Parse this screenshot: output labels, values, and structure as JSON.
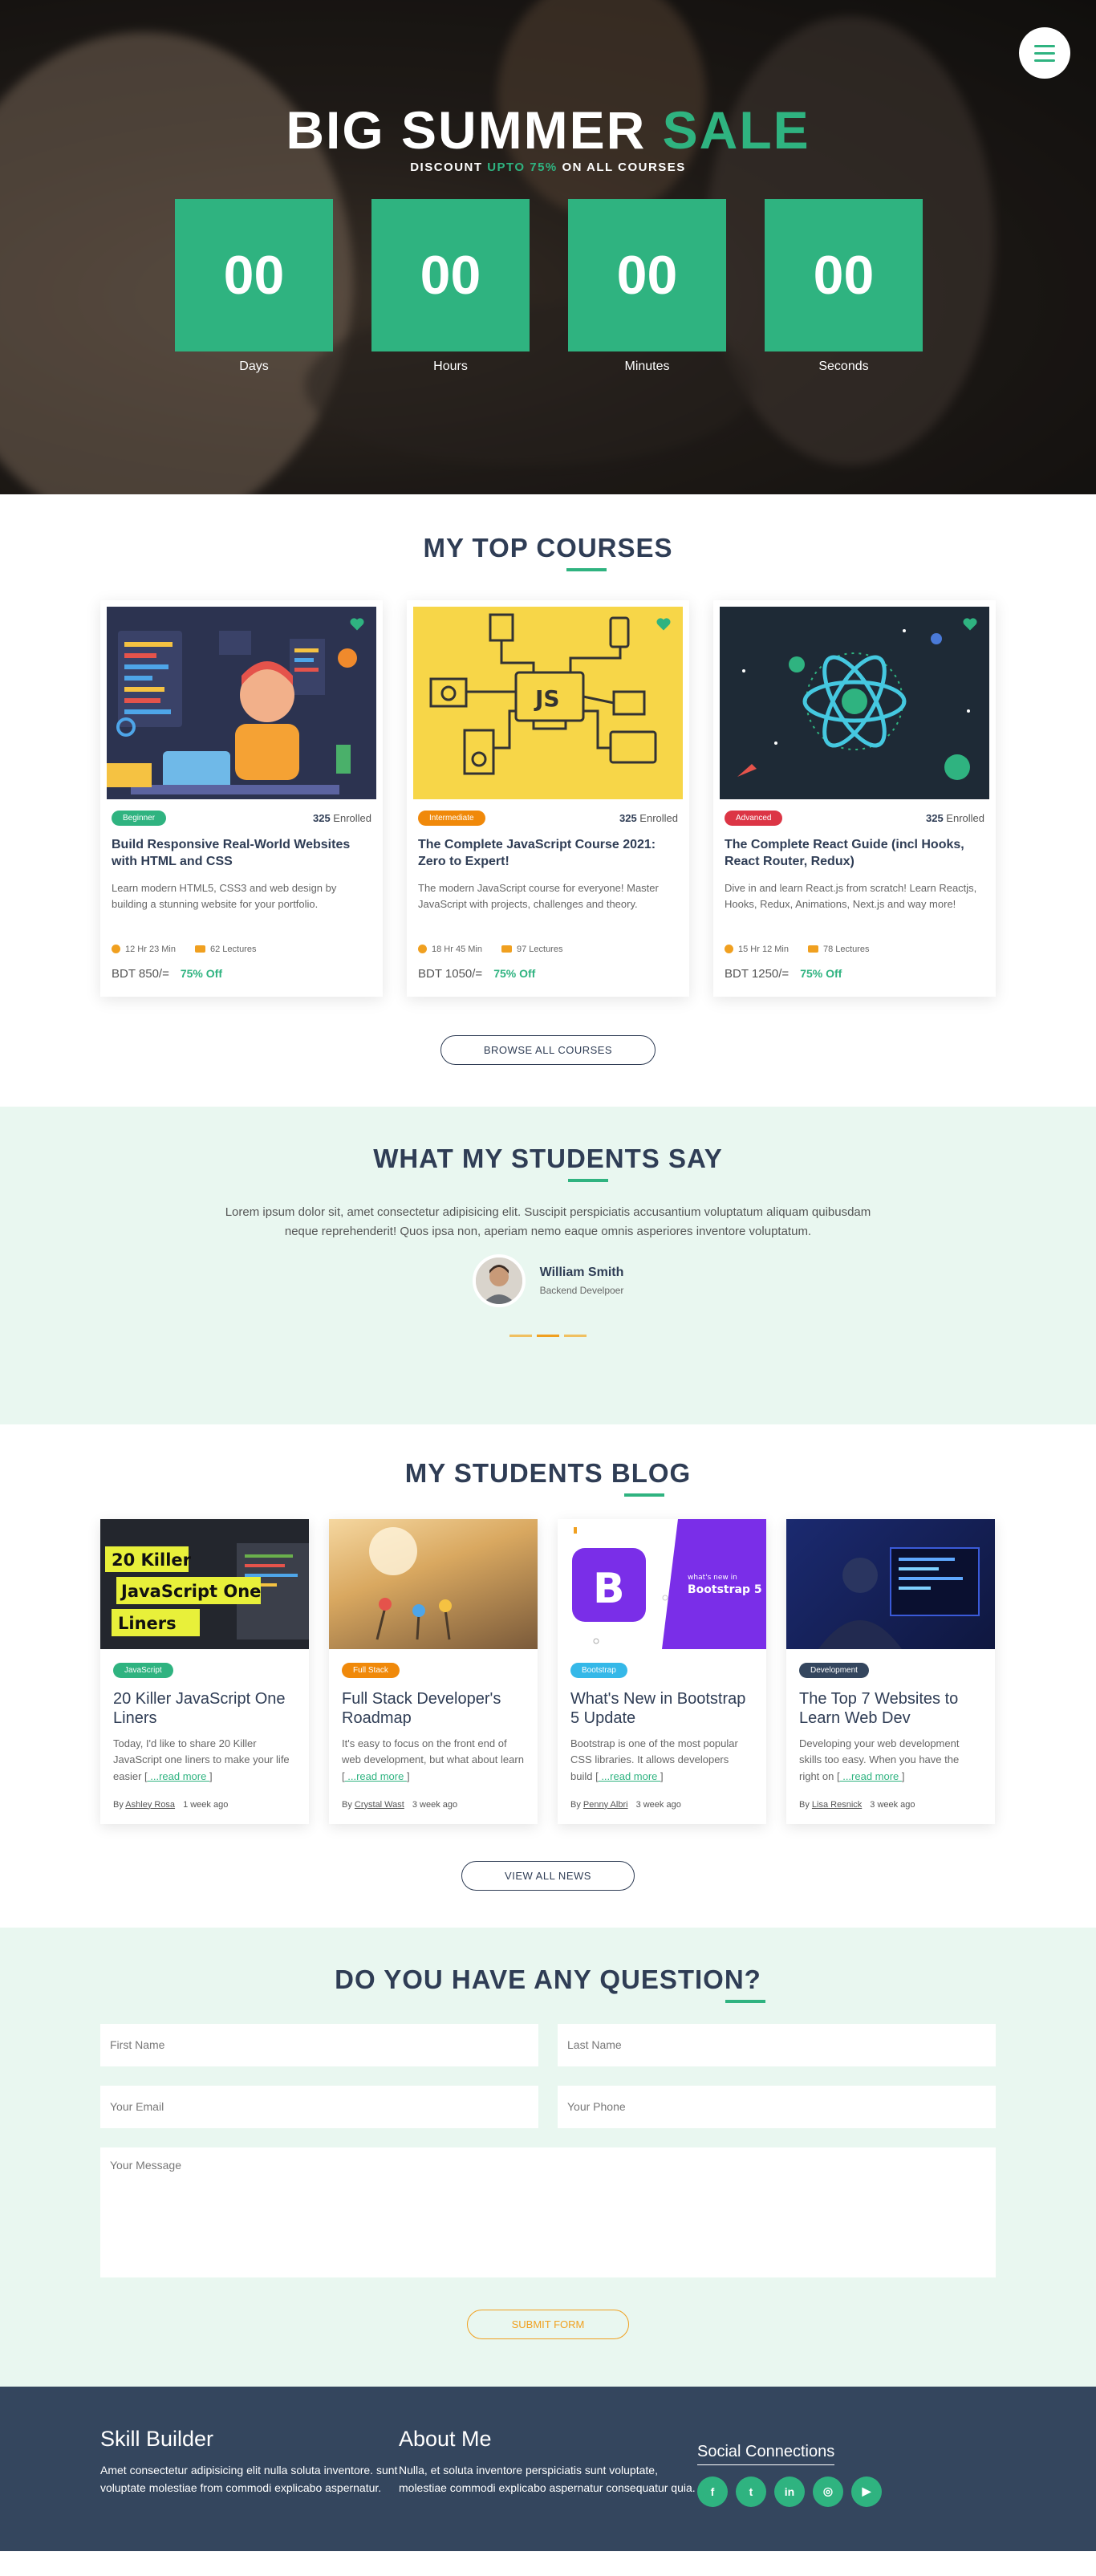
{
  "hero": {
    "title_main": "BIG SUMMER ",
    "title_accent": "SALE",
    "sub_before": "DISCOUNT ",
    "sub_accent": "UPTO 75%",
    "sub_after": " ON ALL COURSES",
    "countdown": [
      {
        "value": "00",
        "label": "Days"
      },
      {
        "value": "00",
        "label": "Hours"
      },
      {
        "value": "00",
        "label": "Minutes"
      },
      {
        "value": "00",
        "label": "Seconds"
      }
    ]
  },
  "courses": {
    "title": "MY TOP COURSES",
    "items": [
      {
        "level": "Beginner",
        "level_color": "#2fb380",
        "enrolled_count": "325",
        "enrolled_label": " Enrolled",
        "title": "Build Responsive Real-World Websites with HTML and CSS",
        "desc": "Learn modern HTML5, CSS3 and web design by building a stunning website for your portfolio.",
        "duration": "12 Hr 23 Min",
        "lectures": "62 Lectures",
        "price": "BDT 850/=",
        "off": "75% Off"
      },
      {
        "level": "Intermediate",
        "level_color": "#f0890a",
        "enrolled_count": "325",
        "enrolled_label": " Enrolled",
        "title": "The Complete JavaScript Course 2021: Zero to Expert!",
        "desc": "The modern JavaScript course for everyone! Master JavaScript with projects, challenges and theory.",
        "duration": "18 Hr 45 Min",
        "lectures": "97 Lectures",
        "price": "BDT 1050/=",
        "off": "75% Off"
      },
      {
        "level": "Advanced",
        "level_color": "#dc3545",
        "enrolled_count": "325",
        "enrolled_label": " Enrolled",
        "title": "The Complete React Guide (incl Hooks, React Router, Redux)",
        "desc": "Dive in and learn React.js from scratch! Learn Reactjs, Hooks, Redux, Animations, Next.js and way more!",
        "duration": "15 Hr 12 Min",
        "lectures": "78 Lectures",
        "price": "BDT 1250/=",
        "off": "75% Off"
      }
    ],
    "browse_label": "BROWSE ALL COURSES"
  },
  "testimonials": {
    "title": "WHAT MY STUDENTS SAY",
    "text": "Lorem ipsum dolor sit, amet consectetur adipisicing elit. Suscipit perspiciatis accusantium voluptatum aliquam quibusdam neque reprehenderit! Quos ipsa non, aperiam nemo eaque omnis asperiores inventore voluptatum.",
    "name": "William Smith",
    "role": "Backend Develpoer"
  },
  "blog": {
    "title": "MY STUDENTS BLOG",
    "items": [
      {
        "tag": "JavaScript",
        "tag_color": "#2fb380",
        "img_caption_line1": "20 Killer",
        "img_caption_line2": "JavaScript One",
        "img_caption_line3": "Liners",
        "title": "20 Killer JavaScript One Liners",
        "desc": "Today, I'd like to share 20 Killer JavaScript one liners to make your life easier [",
        "more": " ...read more ",
        "author": "Ashley Rosa",
        "time": "1 week ago"
      },
      {
        "tag": "Full Stack",
        "tag_color": "#f0890a",
        "title": "Full Stack Developer's Roadmap",
        "desc": "It's easy to focus on the front end of web development, but what about learn [",
        "more": " ...read more ",
        "author": "Crystal Wast",
        "time": "3 week ago"
      },
      {
        "tag": "Bootstrap",
        "tag_color": "#35b8e8",
        "img_caption_small": "what's new in",
        "img_caption_big": "Bootstrap 5",
        "title": "What's New in Bootstrap 5 Update",
        "desc": "Bootstrap is one of the most popular CSS libraries. It allows developers build [",
        "more": " ...read more ",
        "author": "Penny Albri",
        "time": "3 week ago"
      },
      {
        "tag": "Development",
        "tag_color": "#34465e",
        "title": "The Top 7 Websites to Learn Web Dev",
        "desc": "Developing your web development skills too easy. When you have the right on [",
        "more": " ...read more ",
        "author": "Lisa Resnick",
        "time": "3 week ago"
      }
    ],
    "view_label": "VIEW ALL NEWS"
  },
  "contact": {
    "title": "DO YOU HAVE ANY QUESTION?",
    "first_name": "First Name",
    "last_name": "Last Name",
    "email": "Your Email",
    "phone": "Your Phone",
    "message": "Your Message",
    "submit_label": "SUBMIT FORM"
  },
  "footer": {
    "col1_title": "Skill Builder",
    "col1_text": "Amet consectetur adipisicing elit nulla soluta inventore. sunt voluptate molestiae from commodi explicabo aspernatur.",
    "col2_title": "About Me",
    "col2_text": "Nulla, et soluta inventore perspiciatis sunt voluptate, molestiae commodi explicabo aspernatur consequatur quia.",
    "social_title": "Social Connections",
    "social": [
      {
        "icon": "facebook-icon",
        "glyph": "f"
      },
      {
        "icon": "twitter-icon",
        "glyph": "t"
      },
      {
        "icon": "linkedin-icon",
        "glyph": "in"
      },
      {
        "icon": "instagram-icon",
        "glyph": "◎"
      },
      {
        "icon": "youtube-icon",
        "glyph": "▶"
      }
    ]
  },
  "colors": {
    "accent": "#2fb380",
    "dark": "#2f3d55",
    "orange": "#f0a020",
    "mint": "#e9f7f0",
    "footer": "#34465e"
  }
}
